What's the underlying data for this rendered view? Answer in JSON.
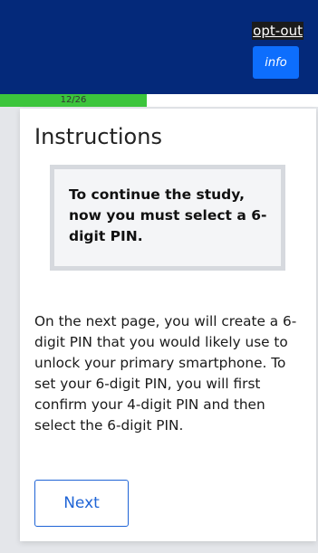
{
  "header": {
    "opt_out_label": "opt-out",
    "info_label": "info",
    "background": "#04297a",
    "info_color": "#0d6efd"
  },
  "progress": {
    "label": "12/26",
    "current": 12,
    "total": 26,
    "color": "#3cc53c"
  },
  "card": {
    "title": "Instructions",
    "callout": "To continue the study, now you must select a 6-digit PIN.",
    "body": "On the next page, you will create a 6-digit PIN that you would likely use to unlock your primary smartphone. To set your 6-digit PIN, you will first confirm your 4-digit PIN and then select the 6-digit PIN.",
    "next_label": "Next"
  }
}
